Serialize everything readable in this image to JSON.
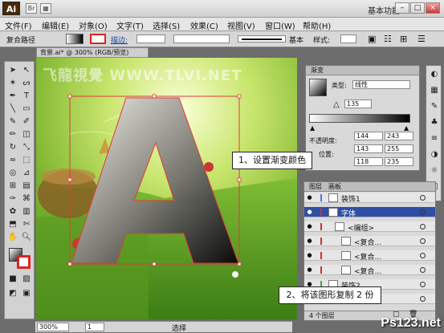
{
  "app": {
    "logo": "Ai",
    "workspace": "基本功能 ▾",
    "min": "–",
    "max": "□",
    "close": "×"
  },
  "menu": [
    "文件(F)",
    "编辑(E)",
    "对象(O)",
    "文字(T)",
    "选择(S)",
    "效果(C)",
    "视图(V)",
    "窗口(W)",
    "帮助(H)"
  ],
  "control_bar": {
    "object_type": "复合路径",
    "stroke_label": "描边:",
    "style_label": "基本",
    "style2_label": "样式:"
  },
  "document_tab": "背景.ai* @ 300% (RGB/预览)",
  "watermark": "飞龍視覺 WWW.TLVI.NET",
  "gradient_panel": {
    "title": "渐变",
    "type_label": "类型:",
    "type_value": "线性",
    "angle": "135",
    "opacity_label": "不透明度:",
    "location_label": "位置:",
    "color_values": [
      "144",
      "243",
      "143",
      "255",
      "118",
      "235"
    ],
    "colors": {
      "start": "#ffffff",
      "end": "#000000"
    }
  },
  "layers_panel": {
    "tabs": [
      "图层",
      "画板"
    ],
    "layers": [
      {
        "name": "装饰1",
        "color": "#4a7ad0",
        "level": 0,
        "selected": false
      },
      {
        "name": "字体",
        "color": "#d23030",
        "level": 0,
        "selected": true
      },
      {
        "name": "<编组>",
        "color": "#d23030",
        "level": 1,
        "selected": false
      },
      {
        "name": "<复合...",
        "color": "#d23030",
        "level": 2,
        "selected": false
      },
      {
        "name": "<复合...",
        "color": "#d23030",
        "level": 2,
        "selected": false
      },
      {
        "name": "<复合...",
        "color": "#d23030",
        "level": 2,
        "selected": false
      },
      {
        "name": "装饰2",
        "color": "#46a846",
        "level": 0,
        "selected": false
      },
      {
        "name": "背景",
        "color": "#46a846",
        "level": 0,
        "selected": false
      }
    ],
    "footer": "4 个图层"
  },
  "callouts": {
    "one": "1、设置渐变颜色",
    "two": "2、将该图形复制 2 份"
  },
  "artwork": {
    "letter": "A"
  },
  "status": {
    "zoom": "300%",
    "page": "1",
    "mode": "选择"
  },
  "site_watermark": "Ps123.net"
}
